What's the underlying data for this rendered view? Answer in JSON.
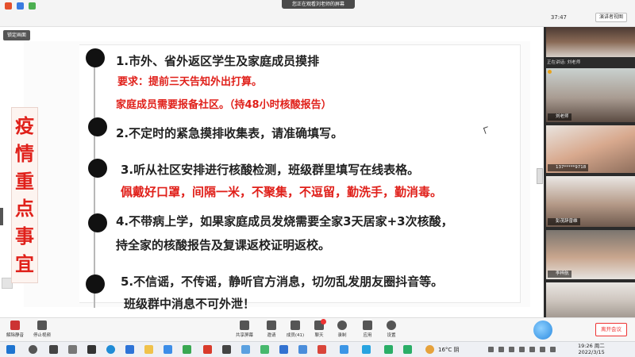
{
  "meeting": {
    "share_banner": "您正在观看刘老师的屏幕",
    "timer": "37:47",
    "view_button": "演讲者视图",
    "lock_button": "锁定画面"
  },
  "slide": {
    "vertical_title": [
      "疫",
      "情",
      "重",
      "点",
      "事",
      "宜"
    ],
    "items": [
      {
        "text": "1.市外、省外返区学生及家庭成员摸排"
      },
      {
        "text": "2.不定时的紧急摸排收集表，请准确填写。"
      },
      {
        "text": "3.听从社区安排进行核酸检测，班级群里填写在线表格。"
      },
      {
        "text": "4.不带病上学，如果家庭成员发烧需要全家3天居家+3次核酸，"
      },
      {
        "text": "持全家的核酸报告及复课返校证明返校。"
      },
      {
        "text": "5.不信谣，不传谣，静听官方消息，切勿乱发朋友圈抖音等。"
      },
      {
        "text": "班级群中消息不可外泄！"
      }
    ],
    "requirement_1": "要求：提前三天告知外出打算。",
    "requirement_2": "家庭成员需要报备社区。（持48小时核酸报告）",
    "reminder": "佩戴好口罩，间隔一米，不聚集，不逗留，勤洗手，勤消毒。"
  },
  "participants": {
    "speaking_tag": "正在讲话: 刘老师",
    "tiles": [
      {
        "name": ""
      },
      {
        "name": "刘老师"
      },
      {
        "name": "137*****9718"
      },
      {
        "name": "彭茂辞曾维"
      },
      {
        "name": "李梓航"
      },
      {
        "name": ""
      }
    ]
  },
  "toolbar": {
    "buttons": [
      {
        "label": "解除静音",
        "icon": "microphone-icon"
      },
      {
        "label": "停止视频",
        "icon": "video-camera-icon"
      },
      {
        "label": "共享屏幕",
        "icon": "share-screen-icon"
      },
      {
        "label": "邀请",
        "icon": "invite-icon"
      },
      {
        "label": "成员(41)",
        "icon": "participants-icon"
      },
      {
        "label": "聊天",
        "icon": "chat-icon"
      },
      {
        "label": "录制",
        "icon": "record-icon"
      },
      {
        "label": "应用",
        "icon": "apps-icon"
      },
      {
        "label": "设置",
        "icon": "settings-icon"
      }
    ],
    "end_button": "离开会议"
  },
  "taskbar": {
    "weather": "16°C 阴",
    "time": "19:26 周二",
    "date": "2022/3/15"
  },
  "colors": {
    "accent_red": "#e0201a",
    "timeline_dot": "#111111",
    "panel_bg": "#2b2b2b"
  }
}
